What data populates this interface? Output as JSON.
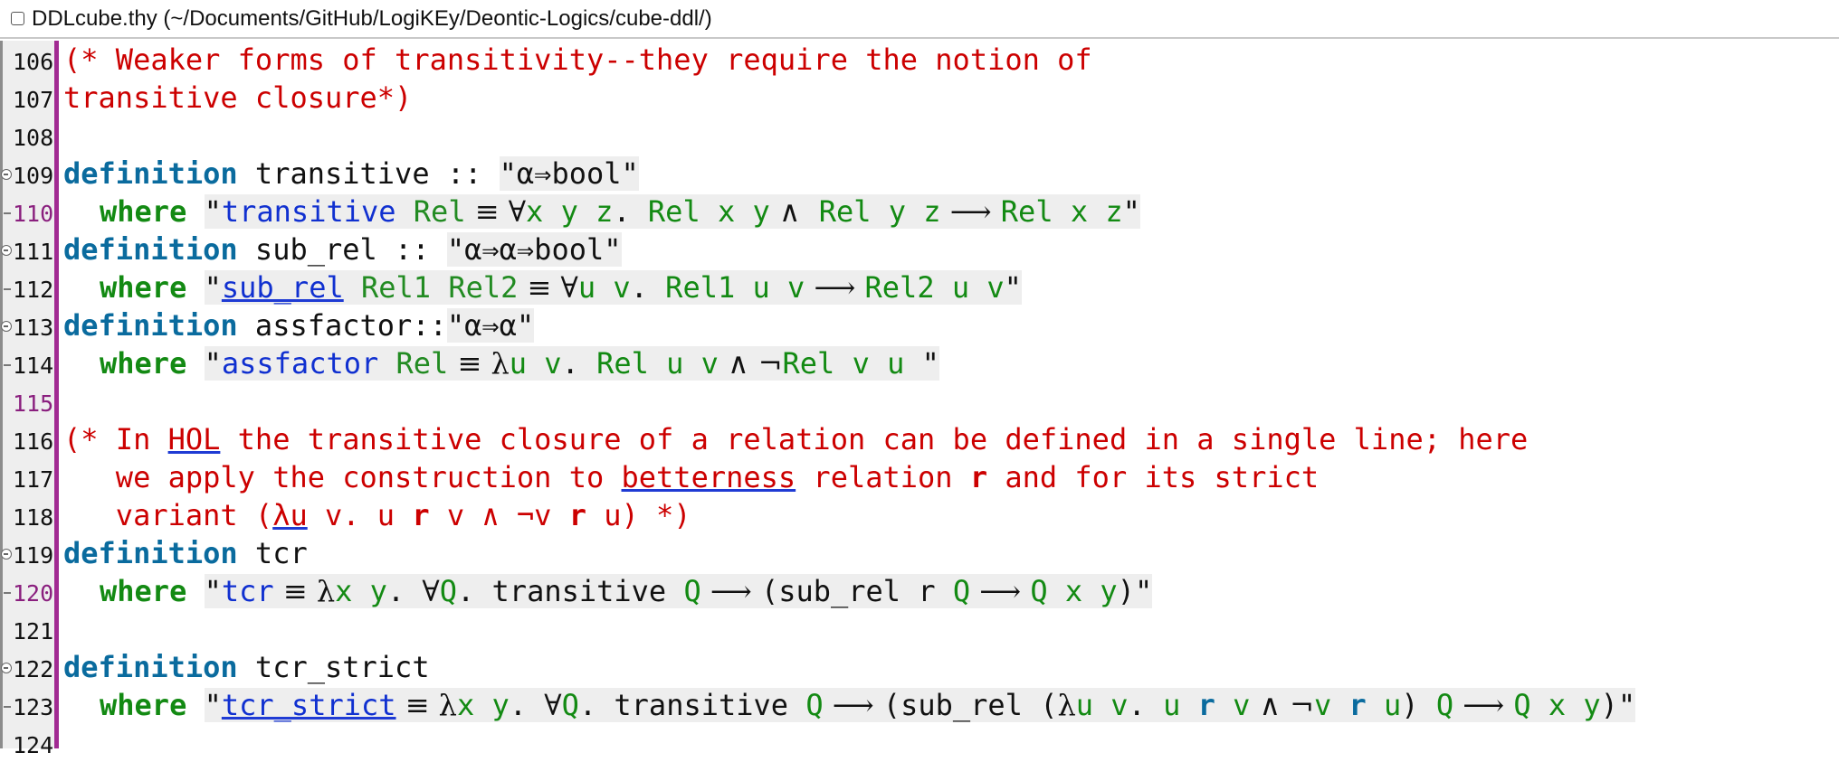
{
  "window": {
    "title": "DDLcube.thy (~/Documents/GitHub/LogiKEy/Deontic-Logics/cube-ddl/)"
  },
  "editor": {
    "lines": [
      {
        "num": "106"
      },
      {
        "num": "107"
      },
      {
        "num": "108"
      },
      {
        "num": "109"
      },
      {
        "num": "110"
      },
      {
        "num": "111"
      },
      {
        "num": "112"
      },
      {
        "num": "113"
      },
      {
        "num": "114"
      },
      {
        "num": "115"
      },
      {
        "num": "116"
      },
      {
        "num": "117"
      },
      {
        "num": "118"
      },
      {
        "num": "119"
      },
      {
        "num": "120"
      },
      {
        "num": "121"
      },
      {
        "num": "122"
      },
      {
        "num": "123"
      },
      {
        "num": "124"
      }
    ],
    "tokens": {
      "l106_comment": "(* Weaker forms of transitivity--they require the notion of",
      "l107_comment": "transitive closure*)",
      "kw_definition": "definition",
      "kw_where": "where",
      "l109_name": " transitive :: ",
      "l109_type": "\"α⇒bool\"",
      "l110_q": "\"",
      "l110_const": "transitive",
      "l110_rel": " Rel",
      "l110_eq": " ≡ ",
      "l110_forall": "∀",
      "l110_xyz": "x y z",
      "l110_dot": ". ",
      "l110_relxy": "Rel x y",
      "l110_and": " ∧  ",
      "l110_relyz": "Rel y z",
      "l110_imp": " ⟶ ",
      "l110_relxz": "Rel x z",
      "l110_end": "\"",
      "l111_name": " sub_rel :: ",
      "l111_type": "\"α⇒α⇒bool\"",
      "l112_q": "\"",
      "l112_const": "sub_rel",
      "l112_args": " Rel1 Rel2",
      "l112_eq": " ≡ ",
      "l112_forall": "∀",
      "l112_uv": "u v",
      "l112_dot": ". ",
      "l112_rel1": "Rel1 u v",
      "l112_imp": " ⟶ ",
      "l112_rel2": "Rel2 u v",
      "l112_end": "\"",
      "l113_name": " assfactor::",
      "l113_type": "\"α⇒α\"",
      "l114_q": "\"",
      "l114_const": "assfactor",
      "l114_rel": " Rel",
      "l114_eq": " ≡ ",
      "l114_lambda": "λ",
      "l114_uv": "u v",
      "l114_dot": ". ",
      "l114_reluv": "Rel u v",
      "l114_and": " ∧ ",
      "l114_neg": "¬",
      "l114_relvu": "Rel v u",
      "l114_end": " \"",
      "l116_a": "(* In ",
      "l116_hol": "HOL",
      "l116_b": " the transitive closure of a relation can be defined in a single line; here",
      "l117_a": "   we apply the construction to ",
      "l117_bet": "betterness",
      "l117_b": " relation ",
      "l117_r": "r",
      "l117_c": " and for its strict",
      "l118_a": "   variant (",
      "l118_lu": "λu",
      "l118_b": " v. u ",
      "l118_r1": "r",
      "l118_c": " v ∧ ¬v ",
      "l118_r2": "r",
      "l118_d": " u) *)",
      "l119_name": " tcr",
      "l120_q": "\"",
      "l120_const": "tcr",
      "l120_eq": " ≡ ",
      "l120_lambda": "λ",
      "l120_xy": "x y",
      "l120_dot": ". ",
      "l120_forall": "∀",
      "l120_Q": "Q",
      "l120_mid": ". transitive ",
      "l120_Q2": "Q",
      "l120_imp1": " ⟶ ",
      "l120_sub": "(sub_rel r ",
      "l120_Q3": "Q",
      "l120_imp2": " ⟶ ",
      "l120_Qxy": "Q x y",
      "l120_end": ")\"",
      "l122_name": " tcr_strict",
      "l123_q": "\"",
      "l123_const": "tcr_strict",
      "l123_eq": " ≡ ",
      "l123_lambda": "λ",
      "l123_xy": "x y",
      "l123_dot": ". ",
      "l123_forall": "∀",
      "l123_Q": "Q",
      "l123_mid": ". transitive ",
      "l123_Q2": "Q",
      "l123_imp1": " ⟶ ",
      "l123_sub": "(sub_rel (",
      "l123_lam2": "λ",
      "l123_uv": "u v",
      "l123_dot2": ". ",
      "l123_u": "u",
      "l123_sp1": " ",
      "l123_r1": "r",
      "l123_sp2": " ",
      "l123_v": "v",
      "l123_and": " ∧ ",
      "l123_neg": "¬",
      "l123_v2": "v",
      "l123_sp3": " ",
      "l123_r2": "r",
      "l123_sp4": " ",
      "l123_u2": "u",
      "l123_close": ") ",
      "l123_Q3": "Q",
      "l123_imp2": " ⟶ ",
      "l123_Qxy": "Q x y",
      "l123_end": ")\""
    }
  }
}
